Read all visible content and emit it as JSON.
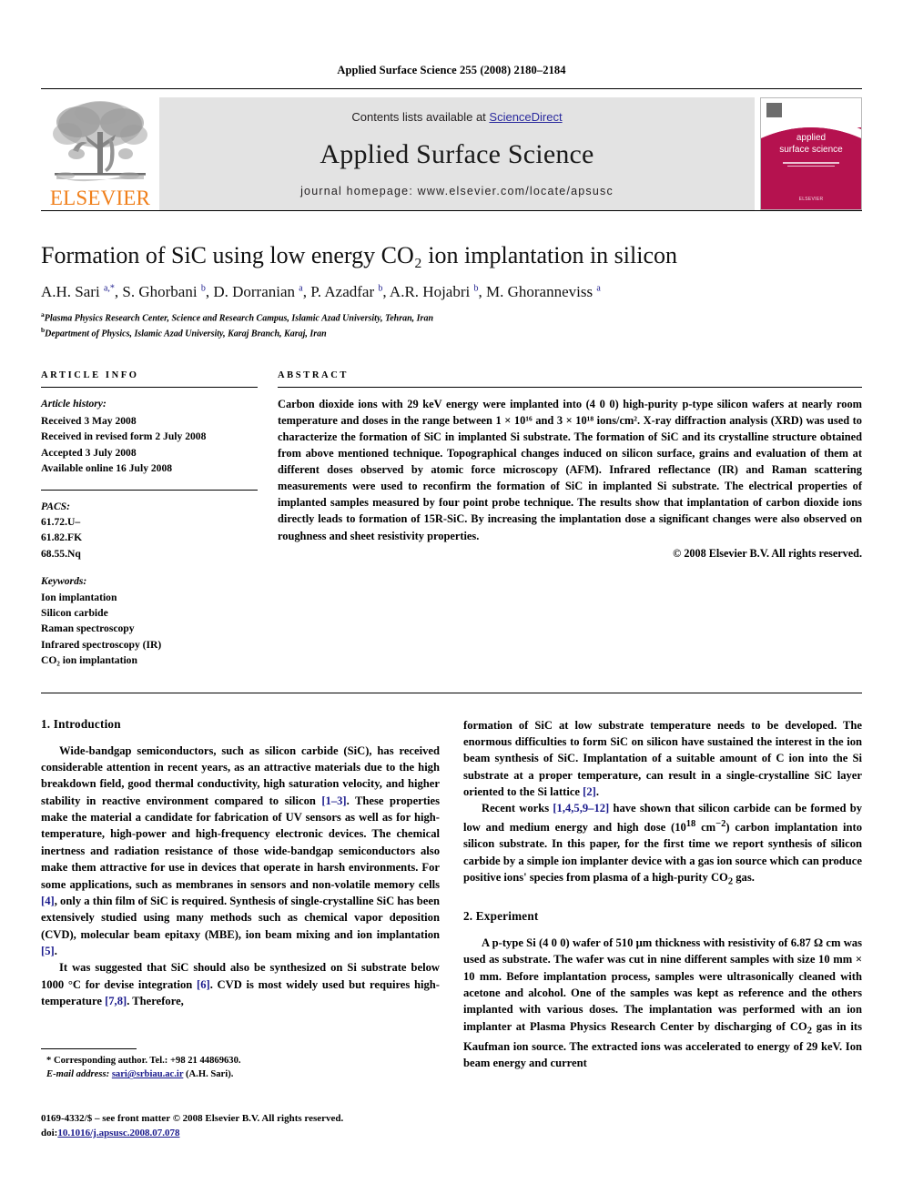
{
  "running_head": "Applied Surface Science 255 (2008) 2180–2184",
  "masthead": {
    "publisher_name": "ELSEVIER",
    "contents_prefix": "Contents lists available at ",
    "contents_link": "ScienceDirect",
    "journal_name": "Applied Surface Science",
    "homepage_line": "journal homepage: www.elsevier.com/locate/apsusc",
    "cover": {
      "title_line1": "applied",
      "title_line2": "surface science",
      "badge": "ELSEVIER",
      "accent_color": "#B5124F"
    },
    "link_color": "#2b2b9e",
    "elsevier_orange": "#F07F1A",
    "band_color": "#e3e3e3"
  },
  "article": {
    "title": "Formation of SiC using low energy CO₂ ion implantation in silicon",
    "authors_html": "A.H. Sari <sup>a,*</sup>, S. Ghorbani <sup>b</sup>, D. Dorranian <sup>a</sup>, P. Azadfar <sup>b</sup>, A.R. Hojabri <sup>b</sup>, M. Ghoranneviss <sup>a</sup>",
    "affiliations": [
      "Plasma Physics Research Center, Science and Research Campus, Islamic Azad University, Tehran, Iran",
      "Department of Physics, Islamic Azad University, Karaj Branch, Karaj, Iran"
    ],
    "affiliation_marks": [
      "a",
      "b"
    ]
  },
  "article_info": {
    "heading": "ARTICLE INFO",
    "history_label": "Article history:",
    "history": [
      "Received 3 May 2008",
      "Received in revised form 2 July 2008",
      "Accepted 3 July 2008",
      "Available online 16 July 2008"
    ],
    "pacs_label": "PACS:",
    "pacs": [
      "61.72.U–",
      "61.82.FK",
      "68.55.Nq"
    ],
    "keywords_label": "Keywords:",
    "keywords": [
      "Ion implantation",
      "Silicon carbide",
      "Raman spectroscopy",
      "Infrared spectroscopy (IR)",
      "CO₂ ion implantation"
    ]
  },
  "abstract": {
    "heading": "ABSTRACT",
    "text": "Carbon dioxide ions with 29 keV energy were implanted into (4 0 0) high-purity p-type silicon wafers at nearly room temperature and doses in the range between 1 × 10¹⁶ and 3 × 10¹⁸ ions/cm². X-ray diffraction analysis (XRD) was used to characterize the formation of SiC in implanted Si substrate. The formation of SiC and its crystalline structure obtained from above mentioned technique. Topographical changes induced on silicon surface, grains and evaluation of them at different doses observed by atomic force microscopy (AFM). Infrared reflectance (IR) and Raman scattering measurements were used to reconfirm the formation of SiC in implanted Si substrate. The electrical properties of implanted samples measured by four point probe technique. The results show that implantation of carbon dioxide ions directly leads to formation of 15R-SiC. By increasing the implantation dose a significant changes were also observed on roughness and sheet resistivity properties.",
    "copyright": "© 2008 Elsevier B.V. All rights reserved."
  },
  "sections": {
    "introduction": {
      "heading": "1. Introduction",
      "paragraph_1_html": "Wide-bandgap semiconductors, such as silicon carbide (SiC), has received considerable attention in recent years, as an attractive materials due to the high breakdown field, good thermal conductivity, high saturation velocity, and higher stability in reactive environment compared to silicon <span class=\"ref\">[1–3]</span>. These properties make the material a candidate for fabrication of UV sensors as well as for high-temperature, high-power and high-frequency electronic devices. The chemical inertness and radiation resistance of those wide-bandgap semiconductors also make them attractive for use in devices that operate in harsh environments. For some applications, such as membranes in sensors and non-volatile memory cells <span class=\"ref\">[4]</span>, only a thin film of SiC is required. Synthesis of single-crystalline SiC has been extensively studied using many methods such as chemical vapor deposition (CVD), molecular beam epitaxy (MBE), ion beam mixing and ion implantation <span class=\"ref\">[5]</span>.",
      "paragraph_2_html": "It was suggested that SiC should also be synthesized on Si substrate below 1000 °C for devise integration <span class=\"ref\">[6]</span>. CVD is most widely used but requires high-temperature <span class=\"ref\">[7,8]</span>. Therefore,",
      "paragraph_3_html": "formation of SiC at low substrate temperature needs to be developed. The enormous difficulties to form SiC on silicon have sustained the interest in the ion beam synthesis of SiC. Implantation of a suitable amount of C ion into the Si substrate at a proper temperature, can result in a single-crystalline SiC layer oriented to the Si lattice <span class=\"ref\">[2]</span>.",
      "paragraph_4_html": "Recent works <span class=\"ref\">[1,4,5,9–12]</span> have shown that silicon carbide can be formed by low and medium energy and high dose (10<sup>18</sup> cm<sup>−2</sup>) carbon implantation into silicon substrate. In this paper, for the first time we report synthesis of silicon carbide by a simple ion implanter device with a gas ion source which can produce positive ions' species from plasma of a high-purity CO<sub>2</sub> gas."
    },
    "experiment": {
      "heading": "2. Experiment",
      "paragraph_1_html": "A p-type Si (4 0 0) wafer of 510 μm thickness with resistivity of 6.87 Ω cm was used as substrate. The wafer was cut in nine different samples with size 10 mm × 10 mm. Before implantation process, samples were ultrasonically cleaned with acetone and alcohol. One of the samples was kept as reference and the others implanted with various doses. The implantation was performed with an ion implanter at Plasma Physics Research Center by discharging of CO<sub>2</sub> gas in its Kaufman ion source. The extracted ions was accelerated to energy of 29 keV. Ion beam energy and current"
    }
  },
  "footnote": {
    "corresponding_author": "* Corresponding author. Tel.: +98 21 44869630.",
    "email_label": "E-mail address:",
    "email": "sari@srbiau.ac.ir",
    "email_suffix": "(A.H. Sari)."
  },
  "footer": {
    "issn_line": "0169-4332/$ – see front matter © 2008 Elsevier B.V. All rights reserved.",
    "doi_label": "doi:",
    "doi_value": "10.1016/j.apsusc.2008.07.078"
  }
}
